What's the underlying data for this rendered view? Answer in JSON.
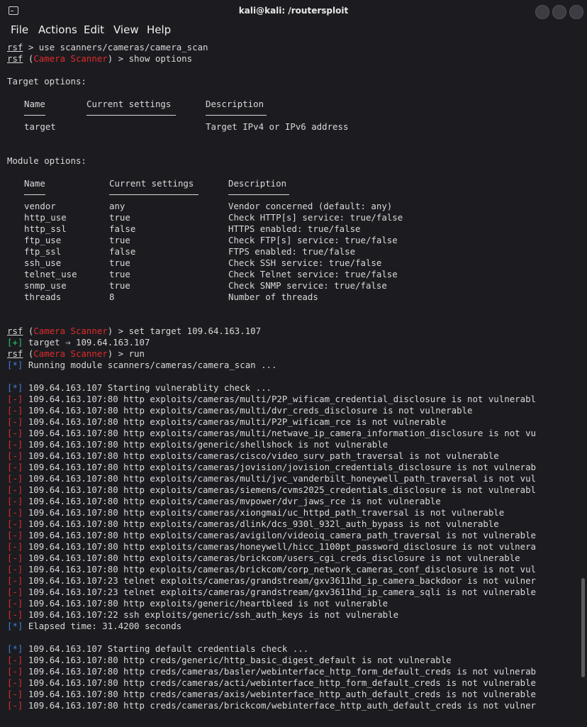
{
  "window": {
    "title": "kali@kali: /routersploit"
  },
  "menu": [
    "File",
    "Actions",
    "Edit",
    "View",
    "Help"
  ],
  "cmd1": {
    "prompt": "rsf",
    "text": " > use scanners/cameras/camera_scan"
  },
  "cmd2": {
    "prompt": "rsf",
    "open": " (",
    "module": "Camera Scanner",
    "close": ") > show options"
  },
  "target_options": {
    "title": "Target options:",
    "headers": [
      "Name",
      "Current settings",
      "Description"
    ],
    "rows": [
      [
        "target",
        "",
        "Target IPv4 or IPv6 address"
      ]
    ]
  },
  "module_options": {
    "title": "Module options:",
    "headers": [
      "Name",
      "Current settings",
      "Description"
    ],
    "rows": [
      [
        "vendor",
        "any",
        "Vendor concerned (default: any)"
      ],
      [
        "http_use",
        "true",
        "Check HTTP[s] service: true/false"
      ],
      [
        "http_ssl",
        "false",
        "HTTPS enabled: true/false"
      ],
      [
        "ftp_use",
        "true",
        "Check FTP[s] service: true/false"
      ],
      [
        "ftp_ssl",
        "false",
        "FTPS enabled: true/false"
      ],
      [
        "ssh_use",
        "true",
        "Check SSH service: true/false"
      ],
      [
        "telnet_use",
        "true",
        "Check Telnet service: true/false"
      ],
      [
        "snmp_use",
        "true",
        "Check SNMP service: true/false"
      ],
      [
        "threads",
        "8",
        "Number of threads"
      ]
    ]
  },
  "cmd3": {
    "prompt": "rsf",
    "open": " (",
    "module": "Camera Scanner",
    "close": ") > set target 109.64.163.107"
  },
  "set_result": {
    "marker": "[+]",
    "text": " target ⇒ 109.64.163.107"
  },
  "cmd4": {
    "prompt": "rsf",
    "open": " (",
    "module": "Camera Scanner",
    "close": ") > run"
  },
  "running": {
    "marker": "[*]",
    "text": " Running module scanners/cameras/camera_scan ..."
  },
  "vuln_start": {
    "marker": "[*]",
    "text": " 109.64.163.107 Starting vulnerablity check ..."
  },
  "vuln_results": [
    " 109.64.163.107:80 http exploits/cameras/multi/P2P_wificam_credential_disclosure is not vulnerabl",
    " 109.64.163.107:80 http exploits/cameras/multi/dvr_creds_disclosure is not vulnerable",
    " 109.64.163.107:80 http exploits/cameras/multi/P2P_wificam_rce is not vulnerable",
    " 109.64.163.107:80 http exploits/cameras/multi/netwave_ip_camera_information_disclosure is not vu",
    " 109.64.163.107:80 http exploits/generic/shellshock is not vulnerable",
    " 109.64.163.107:80 http exploits/cameras/cisco/video_surv_path_traversal is not vulnerable",
    " 109.64.163.107:80 http exploits/cameras/jovision/jovision_credentials_disclosure is not vulnerab",
    " 109.64.163.107:80 http exploits/cameras/multi/jvc_vanderbilt_honeywell_path_traversal is not vul",
    " 109.64.163.107:80 http exploits/cameras/siemens/cvms2025_credentials_disclosure is not vulnerabl",
    " 109.64.163.107:80 http exploits/cameras/mvpower/dvr_jaws_rce is not vulnerable",
    " 109.64.163.107:80 http exploits/cameras/xiongmai/uc_httpd_path_traversal is not vulnerable",
    " 109.64.163.107:80 http exploits/cameras/dlink/dcs_930l_932l_auth_bypass is not vulnerable",
    " 109.64.163.107:80 http exploits/cameras/avigilon/videoiq_camera_path_traversal is not vulnerable",
    " 109.64.163.107:80 http exploits/cameras/honeywell/hicc_1100pt_password_disclosure is not vulnera",
    " 109.64.163.107:80 http exploits/cameras/brickcom/users_cgi_creds_disclosure is not vulnerable",
    " 109.64.163.107:80 http exploits/cameras/brickcom/corp_network_cameras_conf_disclosure is not vul",
    " 109.64.163.107:23 telnet exploits/cameras/grandstream/gxv3611hd_ip_camera_backdoor is not vulner",
    " 109.64.163.107:23 telnet exploits/cameras/grandstream/gxv3611hd_ip_camera_sqli is not vulnerable",
    " 109.64.163.107:80 http exploits/generic/heartbleed is not vulnerable",
    " 109.64.163.107:22 ssh exploits/generic/ssh_auth_keys is not vulnerable"
  ],
  "elapsed": {
    "marker": "[*]",
    "text": " Elapsed time: 31.4200 seconds"
  },
  "creds_start": {
    "marker": "[*]",
    "text": " 109.64.163.107 Starting default credentials check ..."
  },
  "creds_results": [
    " 109.64.163.107:80 http creds/generic/http_basic_digest_default is not vulnerable",
    " 109.64.163.107:80 http creds/cameras/basler/webinterface_http_form_default_creds is not vulnerab",
    " 109.64.163.107:80 http creds/cameras/acti/webinterface_http_form_default_creds is not vulnerable",
    " 109.64.163.107:80 http creds/cameras/axis/webinterface_http_auth_default_creds is not vulnerable",
    " 109.64.163.107:80 http creds/cameras/brickcom/webinterface_http_auth_default_creds is not vulner"
  ],
  "fail_marker": "[-]",
  "colors": {
    "background": "#1c1c20",
    "text": "#d9d9d9",
    "red": "#e02b2b",
    "blue": "#3d7fd9",
    "green": "#27c66c"
  }
}
